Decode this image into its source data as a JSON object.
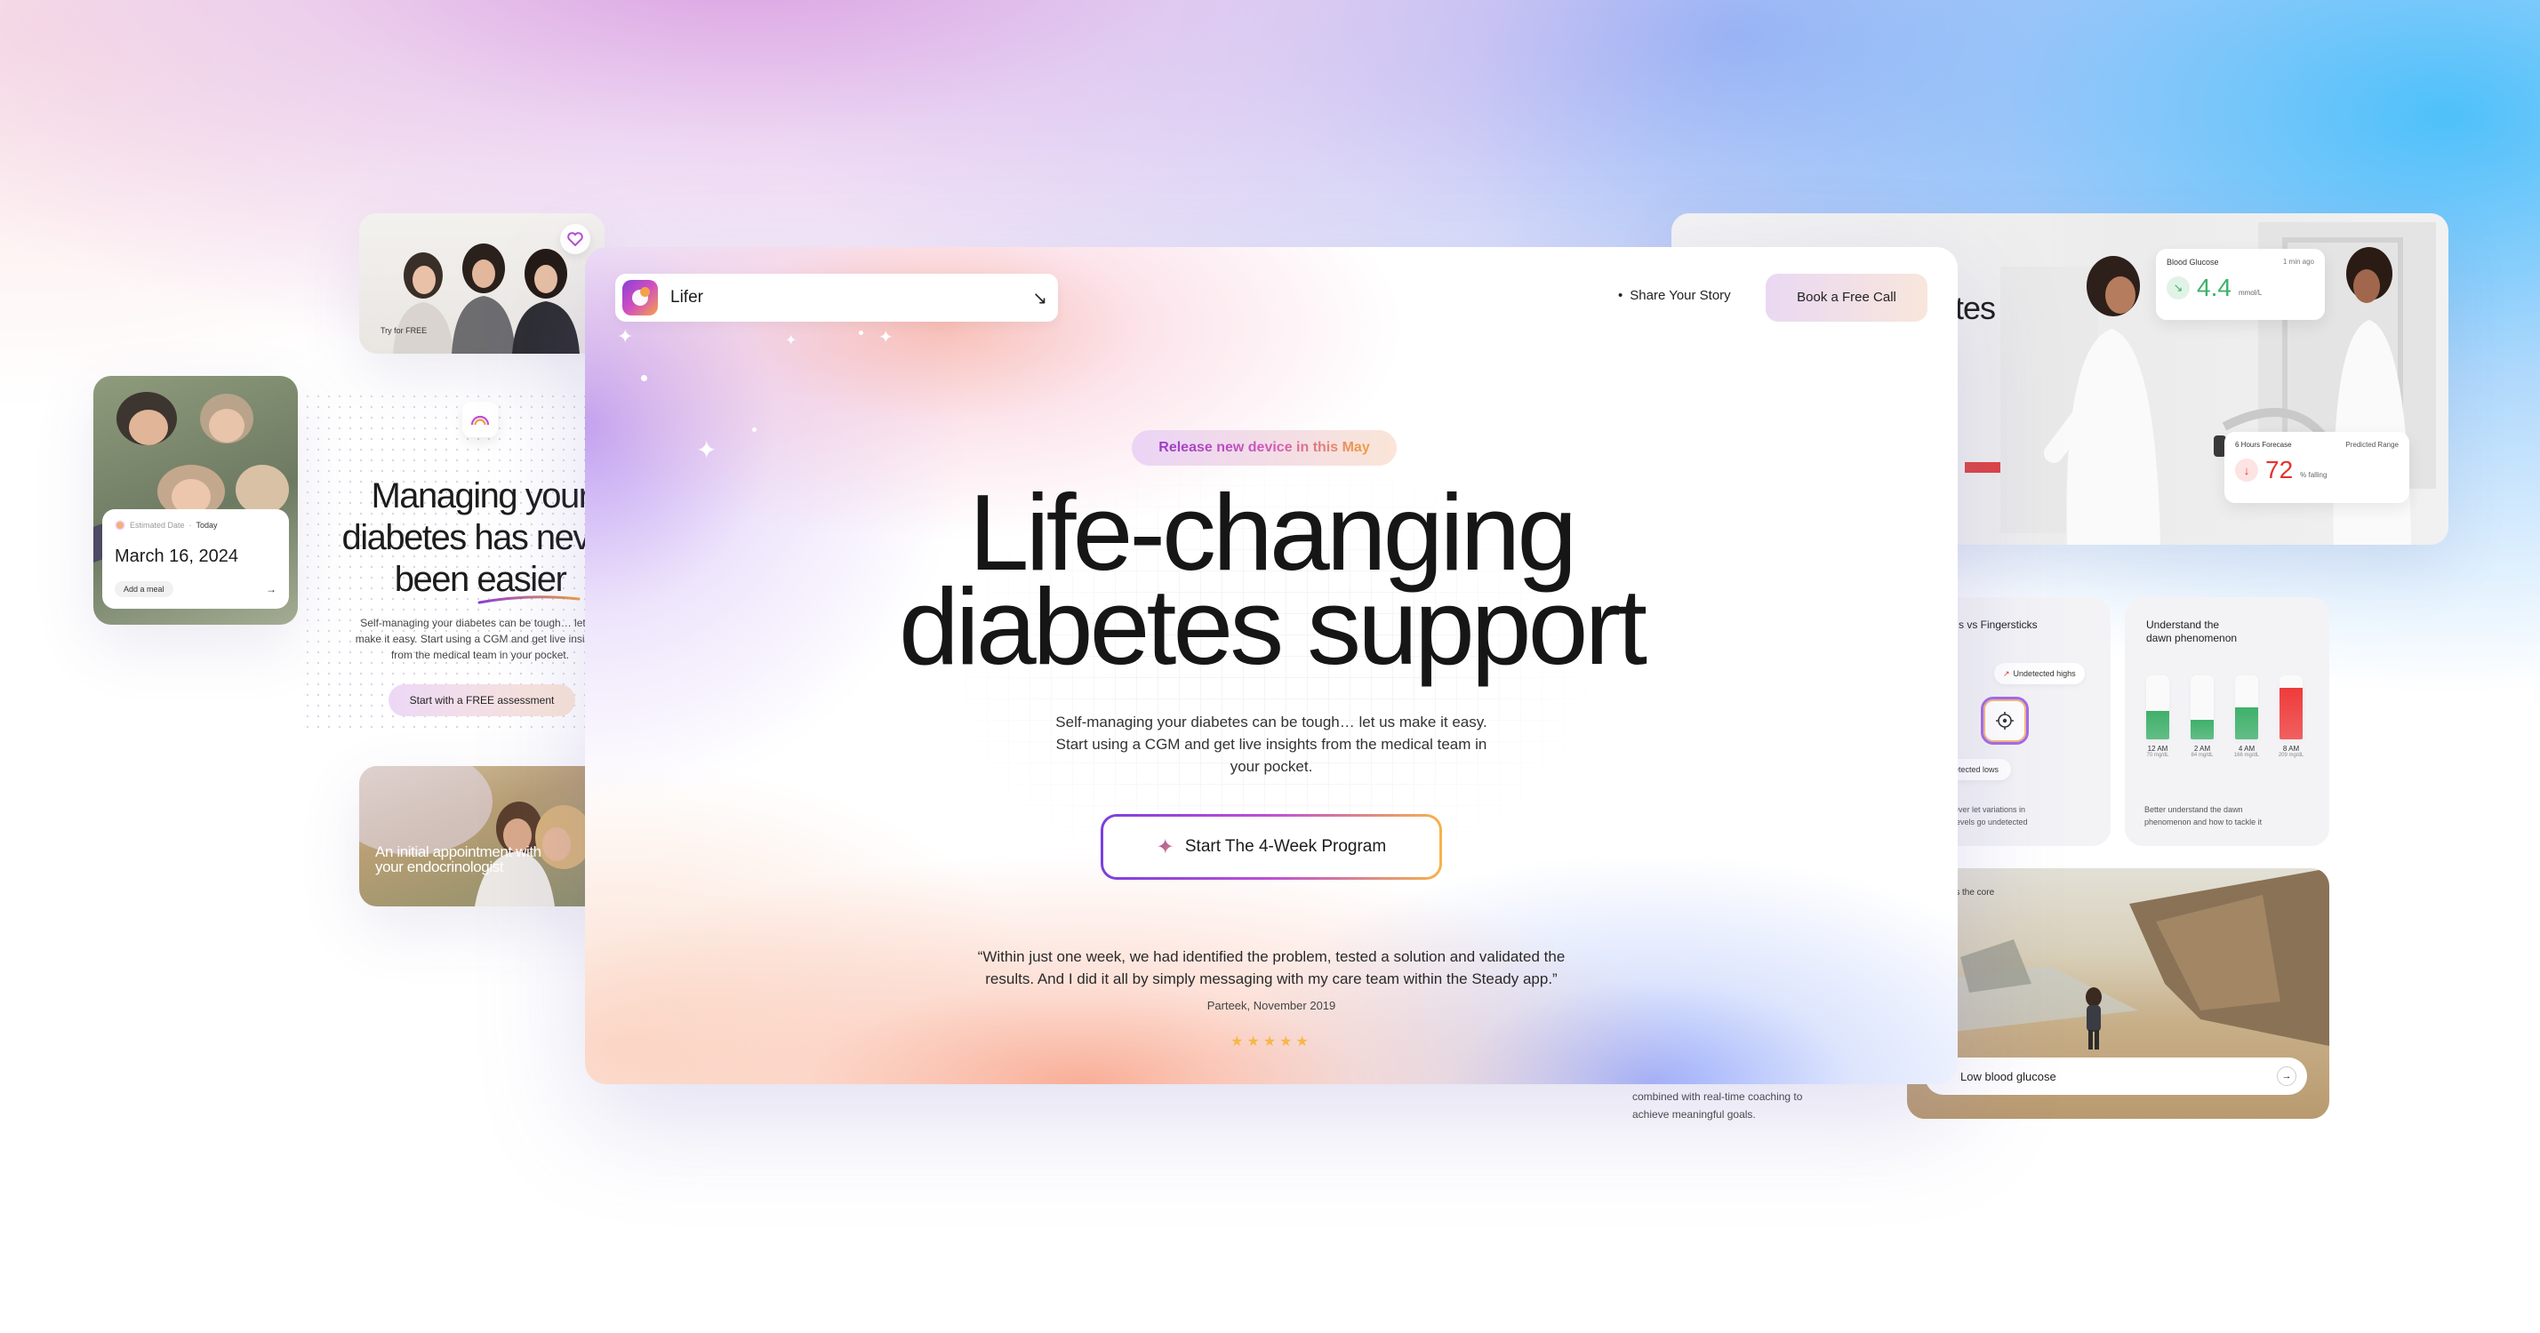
{
  "brand": {
    "name": "Lifer"
  },
  "header": {
    "nav_dot": "•",
    "share_label": "Share Your Story",
    "book_label": "Book a Free Call"
  },
  "hero": {
    "badge": "Release new device in this May",
    "title_line1": "Life-changing",
    "title_line2": "diabetes support",
    "subtitle_line1": "Self-managing your diabetes can be tough… let us make it easy.",
    "subtitle_line2": "Start using a CGM and get live insights from the medical team in",
    "subtitle_line3": "your pocket.",
    "cta_label": "Start The 4-Week Program",
    "quote_line1": "“Within just one week, we had identified the problem, tested a solution and validated the",
    "quote_line2": "results. And I did it all by simply messaging with my care team within the Steady app.”",
    "quote_author": "Parteek, November 2019",
    "rating": 5
  },
  "left": {
    "try_free": "Try for FREE",
    "calendar_meta_label": "Estimated Date",
    "calendar_meta_sep": " · ",
    "calendar_meta_today": "Today",
    "calendar_date": "March 16, 2024",
    "add_meal": "Add a meal",
    "managing_line1": "Managing your",
    "managing_line2": "diabetes has never",
    "managing_line3": "been easier",
    "managing_sub1": "Self-managing your diabetes can be tough… let us",
    "managing_sub2": "make it easy. Start using a CGM and get live insights",
    "managing_sub3": "from the medical team in your pocket.",
    "assessment_cta": "Start with a FREE assessment",
    "appointment_text": "An initial appointment with your endocrinologist"
  },
  "right": {
    "partial_title": "etes",
    "glucose_label": "Blood Glucose",
    "glucose_time": "1 min ago",
    "glucose_value": "4.4",
    "glucose_unit": "mmol/L",
    "forecast_label": "6 Hours Forecase",
    "forecast_range": "Predicted Range",
    "forecast_value": "72",
    "forecast_unit": "% falling",
    "card1_title": "s vs Fingersticks",
    "undetected_highs": "Undetected highs",
    "undetected_lows": "ndetected lows",
    "card1_foot1": "ever let variations in",
    "card1_foot2": "levels go undetected",
    "card2_title1": "Understand the",
    "card2_title2": "dawn phenomenon",
    "dawn_bars": [
      {
        "time": "12 AM",
        "value": "70 mg/dL",
        "level": 0.45,
        "color": "#3fb06a"
      },
      {
        "time": "2 AM",
        "value": "84 mg/dL",
        "level": 0.3,
        "color": "#3fb06a"
      },
      {
        "time": "4 AM",
        "value": "166 mg/dL",
        "level": 0.5,
        "color": "#3fb06a"
      },
      {
        "time": "8 AM",
        "value": "209 mg/dL",
        "level": 0.8,
        "color": "#ef3b3b"
      }
    ],
    "card2_foot1": "Better understand the dawn",
    "card2_foot2": "phenomenon and how to tackle it",
    "core_label": "is the core",
    "low_glucose_label": "Low blood glucose",
    "coaching_line1": "combined with real-time coaching to",
    "coaching_line2": "achieve meaningful goals."
  },
  "colors": {
    "accent_purple": "#9b3cc9",
    "accent_orange": "#f0a040",
    "glucose_green": "#3fb06a",
    "forecast_red": "#e5332a"
  }
}
